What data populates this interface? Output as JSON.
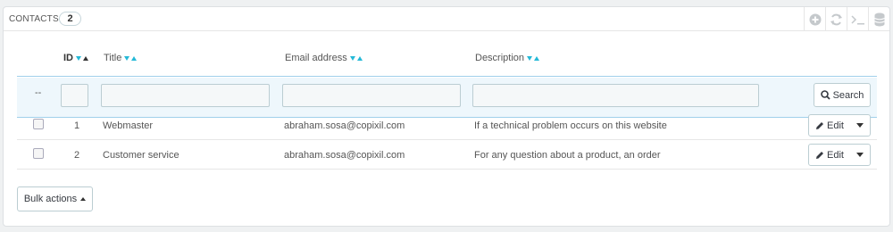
{
  "panel": {
    "title": "CONTACTS",
    "count": "2"
  },
  "toolbar": {
    "icons": [
      "add-icon",
      "refresh-icon",
      "sql-query-icon",
      "database-export-icon"
    ]
  },
  "columns": {
    "id": "ID",
    "title": "Title",
    "email": "Email address",
    "description": "Description"
  },
  "filters": {
    "reset_label": "--",
    "search_label": "Search"
  },
  "rows": [
    {
      "id": "1",
      "title": "Webmaster",
      "email": "abraham.sosa@copixil.com",
      "description": "If a technical problem occurs on this website",
      "action": "Edit"
    },
    {
      "id": "2",
      "title": "Customer service",
      "email": "abraham.sosa@copixil.com",
      "description": "For any question about a product, an order",
      "action": "Edit"
    }
  ],
  "bulk": {
    "label": "Bulk actions"
  },
  "colors": {
    "accent": "#25b9d7",
    "header_border": "#a0d0eb",
    "filter_bg": "#eef7fc"
  }
}
